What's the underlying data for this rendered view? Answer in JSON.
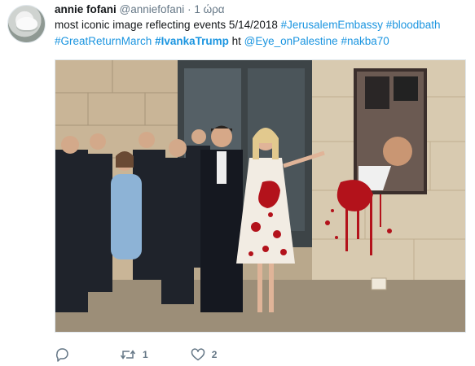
{
  "tweet": {
    "name": "annie fofani",
    "handle": "@anniefofani",
    "separator": "·",
    "time": "1 ώρα",
    "text": {
      "plain1": "most iconic image reflecting events 5/14/2018 ",
      "tag1": "#JerusalemEmbassy",
      "space1": " ",
      "tag2": "#bloodbath",
      "tag3": "#GreatReturnMarch",
      "space2": " ",
      "tag4": "#IvankaTrump",
      "plain2": " ht ",
      "mention": "@Eye_onPalestine",
      "space3": " ",
      "tag5": "#nakba70"
    }
  },
  "actions": {
    "reply_icon": "speech-bubble-icon",
    "retweet_icon": "retweet-arrows-icon",
    "retweet_count": "1",
    "like_icon": "heart-outline-icon",
    "like_count": "2"
  },
  "colors": {
    "link": "#1b95e0",
    "muted": "#657786",
    "text": "#14171a"
  }
}
